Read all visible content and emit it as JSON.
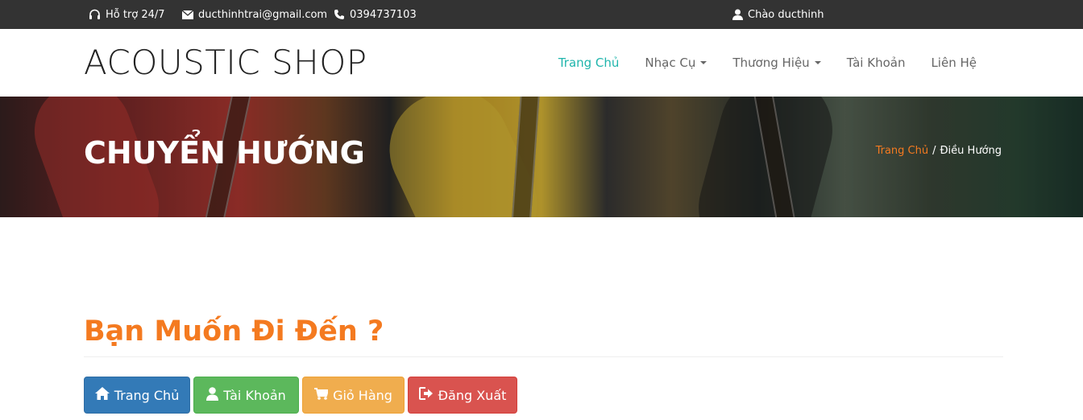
{
  "topbar": {
    "support": "Hỗ trợ 24/7",
    "email": "ducthinhtrai@gmail.com",
    "phone": "0394737103",
    "greeting": "Chào ducthinh"
  },
  "header": {
    "logo": "ACOUSTIC SHOP",
    "nav": [
      {
        "label": "Trang Chủ"
      },
      {
        "label": "Nhạc Cụ"
      },
      {
        "label": "Thương Hiệu"
      },
      {
        "label": "Tài Khoản"
      },
      {
        "label": "Liên Hệ"
      }
    ]
  },
  "banner": {
    "title": "CHUYỂN HƯỚNG",
    "breadcrumb_home": "Trang Chủ",
    "breadcrumb_sep": "/",
    "breadcrumb_current": "Điều Hướng"
  },
  "main": {
    "heading": "Bạn Muốn Đi Đến ?",
    "buttons": [
      {
        "label": "Trang Chủ",
        "icon": "home-icon",
        "color": "#337ab7"
      },
      {
        "label": "Tài Khoản",
        "icon": "user-icon",
        "color": "#5cb85c"
      },
      {
        "label": "Giỏ Hàng",
        "icon": "cart-icon",
        "color": "#f0ad4e"
      },
      {
        "label": "Đăng Xuất",
        "icon": "logout-icon",
        "color": "#d9534f"
      }
    ]
  },
  "colors": {
    "accent": "#1fb5ac",
    "orange": "#f47a20",
    "topbar": "#333333"
  }
}
